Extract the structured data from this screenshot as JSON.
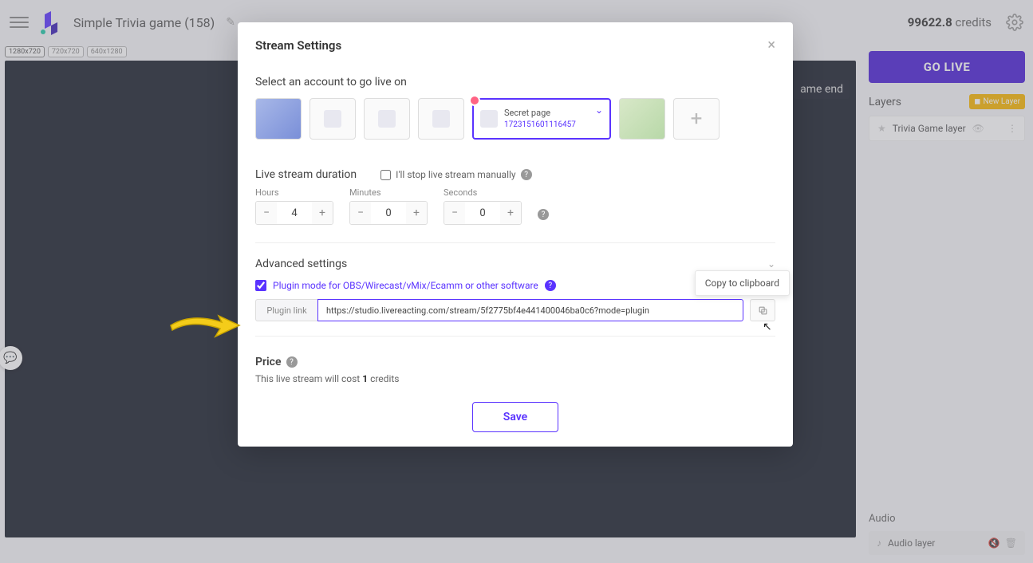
{
  "header": {
    "project_title": "Simple Trivia game (158)",
    "credits_value": "99622.8",
    "credits_label": "credits",
    "go_live": "GO LIVE"
  },
  "resolutions": [
    "1280x720",
    "720x720",
    "640x1280"
  ],
  "preview": {
    "widget_text": "ame end"
  },
  "layers": {
    "title": "Layers",
    "new_layer": "New Layer",
    "items": [
      {
        "name": "Trivia Game layer"
      }
    ]
  },
  "audio": {
    "title": "Audio",
    "items": [
      {
        "name": "Audio layer"
      }
    ]
  },
  "modal": {
    "title": "Stream Settings",
    "select_account": "Select an account to go live on",
    "selected_account": {
      "name": "Secret page",
      "id": "1723151601116457"
    },
    "duration_title": "Live stream duration",
    "stop_manual": "I'll stop live stream manually",
    "hours_label": "Hours",
    "minutes_label": "Minutes",
    "seconds_label": "Seconds",
    "hours": "4",
    "minutes": "0",
    "seconds": "0",
    "advanced_title": "Advanced settings",
    "plugin_label": "Plugin mode for OBS/Wirecast/vMix/Ecamm or other software",
    "plugin_link_label": "Plugin link",
    "plugin_link": "https://studio.livereacting.com/stream/5f2775bf4e441400046ba0c6?mode=plugin",
    "copy_tooltip": "Copy to clipboard",
    "price_title": "Price",
    "price_text_pre": "This live stream will cost ",
    "price_value": "1",
    "price_text_post": " credits",
    "save": "Save"
  }
}
